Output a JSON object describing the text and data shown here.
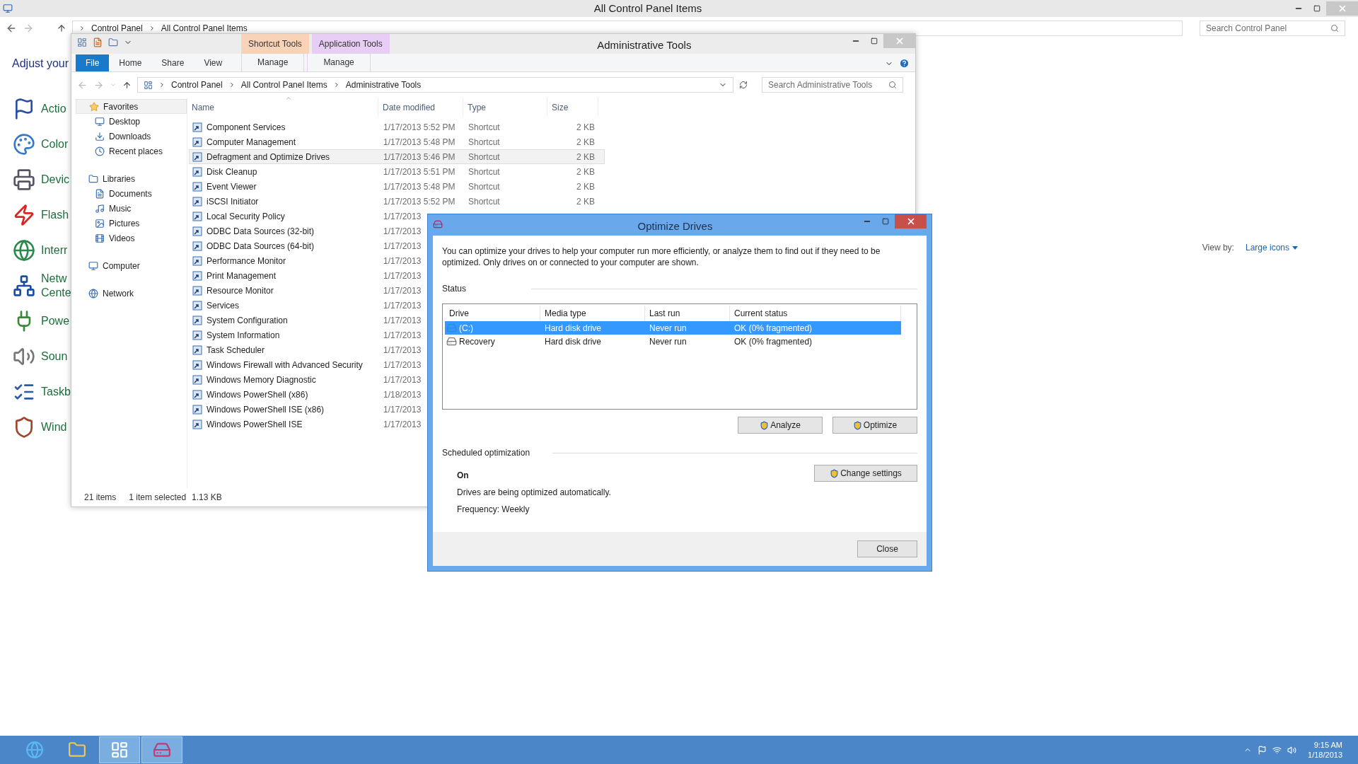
{
  "back_window": {
    "title": "All Control Panel Items",
    "breadcrumb": [
      "Control Panel",
      "All Control Panel Items"
    ],
    "search": {
      "placeholder": "Search Control Panel"
    },
    "heading": "Adjust your",
    "view_by": {
      "label": "View by:",
      "value": "Large icons"
    },
    "items": [
      {
        "lines": [
          "Actio"
        ]
      },
      {
        "lines": [
          "Color"
        ]
      },
      {
        "lines": [
          "Devic"
        ]
      },
      {
        "lines": [
          "Flash"
        ]
      },
      {
        "lines": [
          "Interr"
        ]
      },
      {
        "lines": [
          "Netw",
          "Cente"
        ]
      },
      {
        "lines": [
          "Powe"
        ]
      },
      {
        "lines": [
          "Soun"
        ]
      },
      {
        "lines": [
          "Taskb"
        ]
      },
      {
        "lines": [
          "Wind"
        ]
      }
    ]
  },
  "explorer": {
    "title": "Administrative Tools",
    "context_tabs": [
      {
        "group": "Shortcut Tools",
        "tab": "Manage",
        "color": "#f9d3b8"
      },
      {
        "group": "Application Tools",
        "tab": "Manage",
        "color": "#e8cdf5"
      }
    ],
    "ribbon_tabs": [
      {
        "label": "File",
        "selected": true
      },
      {
        "label": "Home",
        "selected": false
      },
      {
        "label": "Share",
        "selected": false
      },
      {
        "label": "View",
        "selected": false
      }
    ],
    "breadcrumb": [
      "Control Panel",
      "All Control Panel Items",
      "Administrative Tools"
    ],
    "search": {
      "placeholder": "Search Administrative Tools"
    },
    "nav": [
      {
        "label": "Favorites",
        "selected": true,
        "children": [
          {
            "label": "Desktop"
          },
          {
            "label": "Downloads"
          },
          {
            "label": "Recent places"
          }
        ]
      },
      {
        "label": "Libraries",
        "selected": false,
        "children": [
          {
            "label": "Documents"
          },
          {
            "label": "Music"
          },
          {
            "label": "Pictures"
          },
          {
            "label": "Videos"
          }
        ]
      },
      {
        "label": "Computer",
        "selected": false
      },
      {
        "label": "Network",
        "selected": false
      }
    ],
    "columns": [
      "Name",
      "Date modified",
      "Type",
      "Size"
    ],
    "rows": [
      {
        "name": "Component Services",
        "date": "1/17/2013 5:52 PM",
        "type": "Shortcut",
        "size": "2 KB",
        "selected": false
      },
      {
        "name": "Computer Management",
        "date": "1/17/2013 5:48 PM",
        "type": "Shortcut",
        "size": "2 KB",
        "selected": false
      },
      {
        "name": "Defragment and Optimize Drives",
        "date": "1/17/2013 5:46 PM",
        "type": "Shortcut",
        "size": "2 KB",
        "selected": true
      },
      {
        "name": "Disk Cleanup",
        "date": "1/17/2013 5:51 PM",
        "type": "Shortcut",
        "size": "2 KB",
        "selected": false
      },
      {
        "name": "Event Viewer",
        "date": "1/17/2013 5:48 PM",
        "type": "Shortcut",
        "size": "2 KB",
        "selected": false
      },
      {
        "name": "iSCSI Initiator",
        "date": "1/17/2013 5:52 PM",
        "type": "Shortcut",
        "size": "2 KB",
        "selected": false
      },
      {
        "name": "Local Security Policy",
        "date": "1/17/2013",
        "selected": false
      },
      {
        "name": "ODBC Data Sources (32-bit)",
        "date": "1/17/2013",
        "selected": false
      },
      {
        "name": "ODBC Data Sources (64-bit)",
        "date": "1/17/2013",
        "selected": false
      },
      {
        "name": "Performance Monitor",
        "date": "1/17/2013",
        "selected": false
      },
      {
        "name": "Print Management",
        "date": "1/17/2013",
        "selected": false
      },
      {
        "name": "Resource Monitor",
        "date": "1/17/2013",
        "selected": false
      },
      {
        "name": "Services",
        "date": "1/17/2013",
        "selected": false
      },
      {
        "name": "System Configuration",
        "date": "1/17/2013",
        "selected": false
      },
      {
        "name": "System Information",
        "date": "1/17/2013",
        "selected": false
      },
      {
        "name": "Task Scheduler",
        "date": "1/17/2013",
        "selected": false
      },
      {
        "name": "Windows Firewall with Advanced Security",
        "date": "1/17/2013",
        "selected": false
      },
      {
        "name": "Windows Memory Diagnostic",
        "date": "1/17/2013",
        "selected": false
      },
      {
        "name": "Windows PowerShell (x86)",
        "date": "1/18/2013",
        "selected": false
      },
      {
        "name": "Windows PowerShell ISE (x86)",
        "date": "1/17/2013",
        "selected": false
      },
      {
        "name": "Windows PowerShell ISE",
        "date": "1/17/2013",
        "selected": false
      }
    ],
    "status": [
      "21 items",
      "1 item selected",
      "1.13 KB"
    ]
  },
  "dialog": {
    "title": "Optimize Drives",
    "description": "You can optimize your drives to help your computer run more efficiently, or analyze them to find out if they need to be optimized. Only drives on or connected to your computer are shown.",
    "status_heading": "Status",
    "columns": [
      "Drive",
      "Media type",
      "Last run",
      "Current status"
    ],
    "drives": [
      {
        "kind": "system",
        "name": "(C:)",
        "media_type": "Hard disk drive",
        "last_run": "Never run",
        "status": "OK (0% fragmented)",
        "selected": true
      },
      {
        "kind": "plain",
        "name": "Recovery",
        "media_type": "Hard disk drive",
        "last_run": "Never run",
        "status": "OK (0% fragmented)",
        "selected": false
      }
    ],
    "buttons": [
      "Analyze",
      "Optimize"
    ],
    "schedule": {
      "heading": "Scheduled optimization",
      "state": "On",
      "description": "Drives are being optimized automatically.",
      "frequency": "Frequency: Weekly",
      "button": "Change settings"
    },
    "close": "Close"
  },
  "taskbar": {
    "apps": [
      {
        "selected": false
      },
      {
        "selected": false
      },
      {
        "selected": true
      },
      {
        "selected": true
      }
    ],
    "time": "9:15 AM",
    "date": "1/18/2013"
  }
}
